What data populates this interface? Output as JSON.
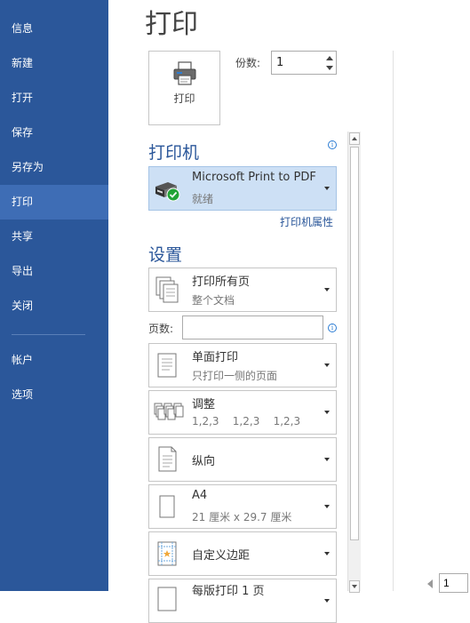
{
  "sidebar": {
    "items": [
      {
        "label": "信息"
      },
      {
        "label": "新建"
      },
      {
        "label": "打开"
      },
      {
        "label": "保存"
      },
      {
        "label": "另存为"
      },
      {
        "label": "打印"
      },
      {
        "label": "共享"
      },
      {
        "label": "导出"
      },
      {
        "label": "关闭"
      },
      {
        "label": "帐户"
      },
      {
        "label": "选项"
      }
    ],
    "active": "打印"
  },
  "header": {
    "title": "打印"
  },
  "print_button": {
    "label": "打印",
    "icon": "printer-icon"
  },
  "copies": {
    "label": "份数:",
    "value": "1"
  },
  "printer": {
    "heading": "打印机",
    "name": "Microsoft Print to PDF",
    "status": "就绪",
    "properties_link": "打印机属性",
    "icon": "printer-ready-icon"
  },
  "settings": {
    "heading": "设置",
    "range": {
      "main": "打印所有页",
      "sub": "整个文档",
      "icon": "pages-icon"
    },
    "pages": {
      "label": "页数:",
      "value": ""
    },
    "sides": {
      "main": "单面打印",
      "sub": "只打印一侧的页面",
      "icon": "single-side-icon"
    },
    "collate": {
      "main": "调整",
      "sub": "1,2,3    1,2,3    1,2,3",
      "icon": "collate-icon"
    },
    "orientation": {
      "main": "纵向",
      "icon": "portrait-icon"
    },
    "paper": {
      "main": "A4",
      "sub": "21 厘米 x 29.7 厘米",
      "icon": "paper-icon"
    },
    "margins": {
      "main": "自定义边距",
      "icon": "margins-icon"
    },
    "per_sheet": {
      "main": "每版打印 1 页",
      "icon": "per-sheet-icon"
    }
  },
  "preview": {
    "page_number": "1"
  },
  "colors": {
    "sidebar": "#2b579a",
    "active": "#3e6db5",
    "accent": "#2b579a",
    "selected": "#cde0f5"
  }
}
